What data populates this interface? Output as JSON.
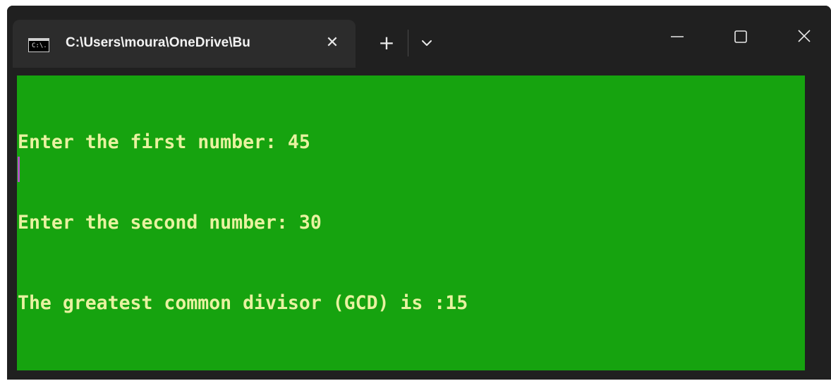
{
  "window": {
    "tab_title": "C:\\Users\\moura\\OneDrive\\Bu",
    "tab_icon_text": "C:\\.",
    "new_tab_label": "+",
    "close_tab_label": "✕"
  },
  "console": {
    "lines": [
      "Enter the first number: 45",
      "Enter the second number: 30",
      "The greatest common divisor (GCD) is :15"
    ]
  },
  "colors": {
    "console_background": "#16a30f",
    "console_text": "#e8f2a0",
    "titlebar": "#202020",
    "cursor": "#b455c9"
  },
  "icons": {
    "tab_icon": "terminal-icon",
    "dropdown": "chevron-down-icon",
    "minimize": "minimize-icon",
    "maximize": "maximize-icon",
    "close": "close-icon"
  }
}
